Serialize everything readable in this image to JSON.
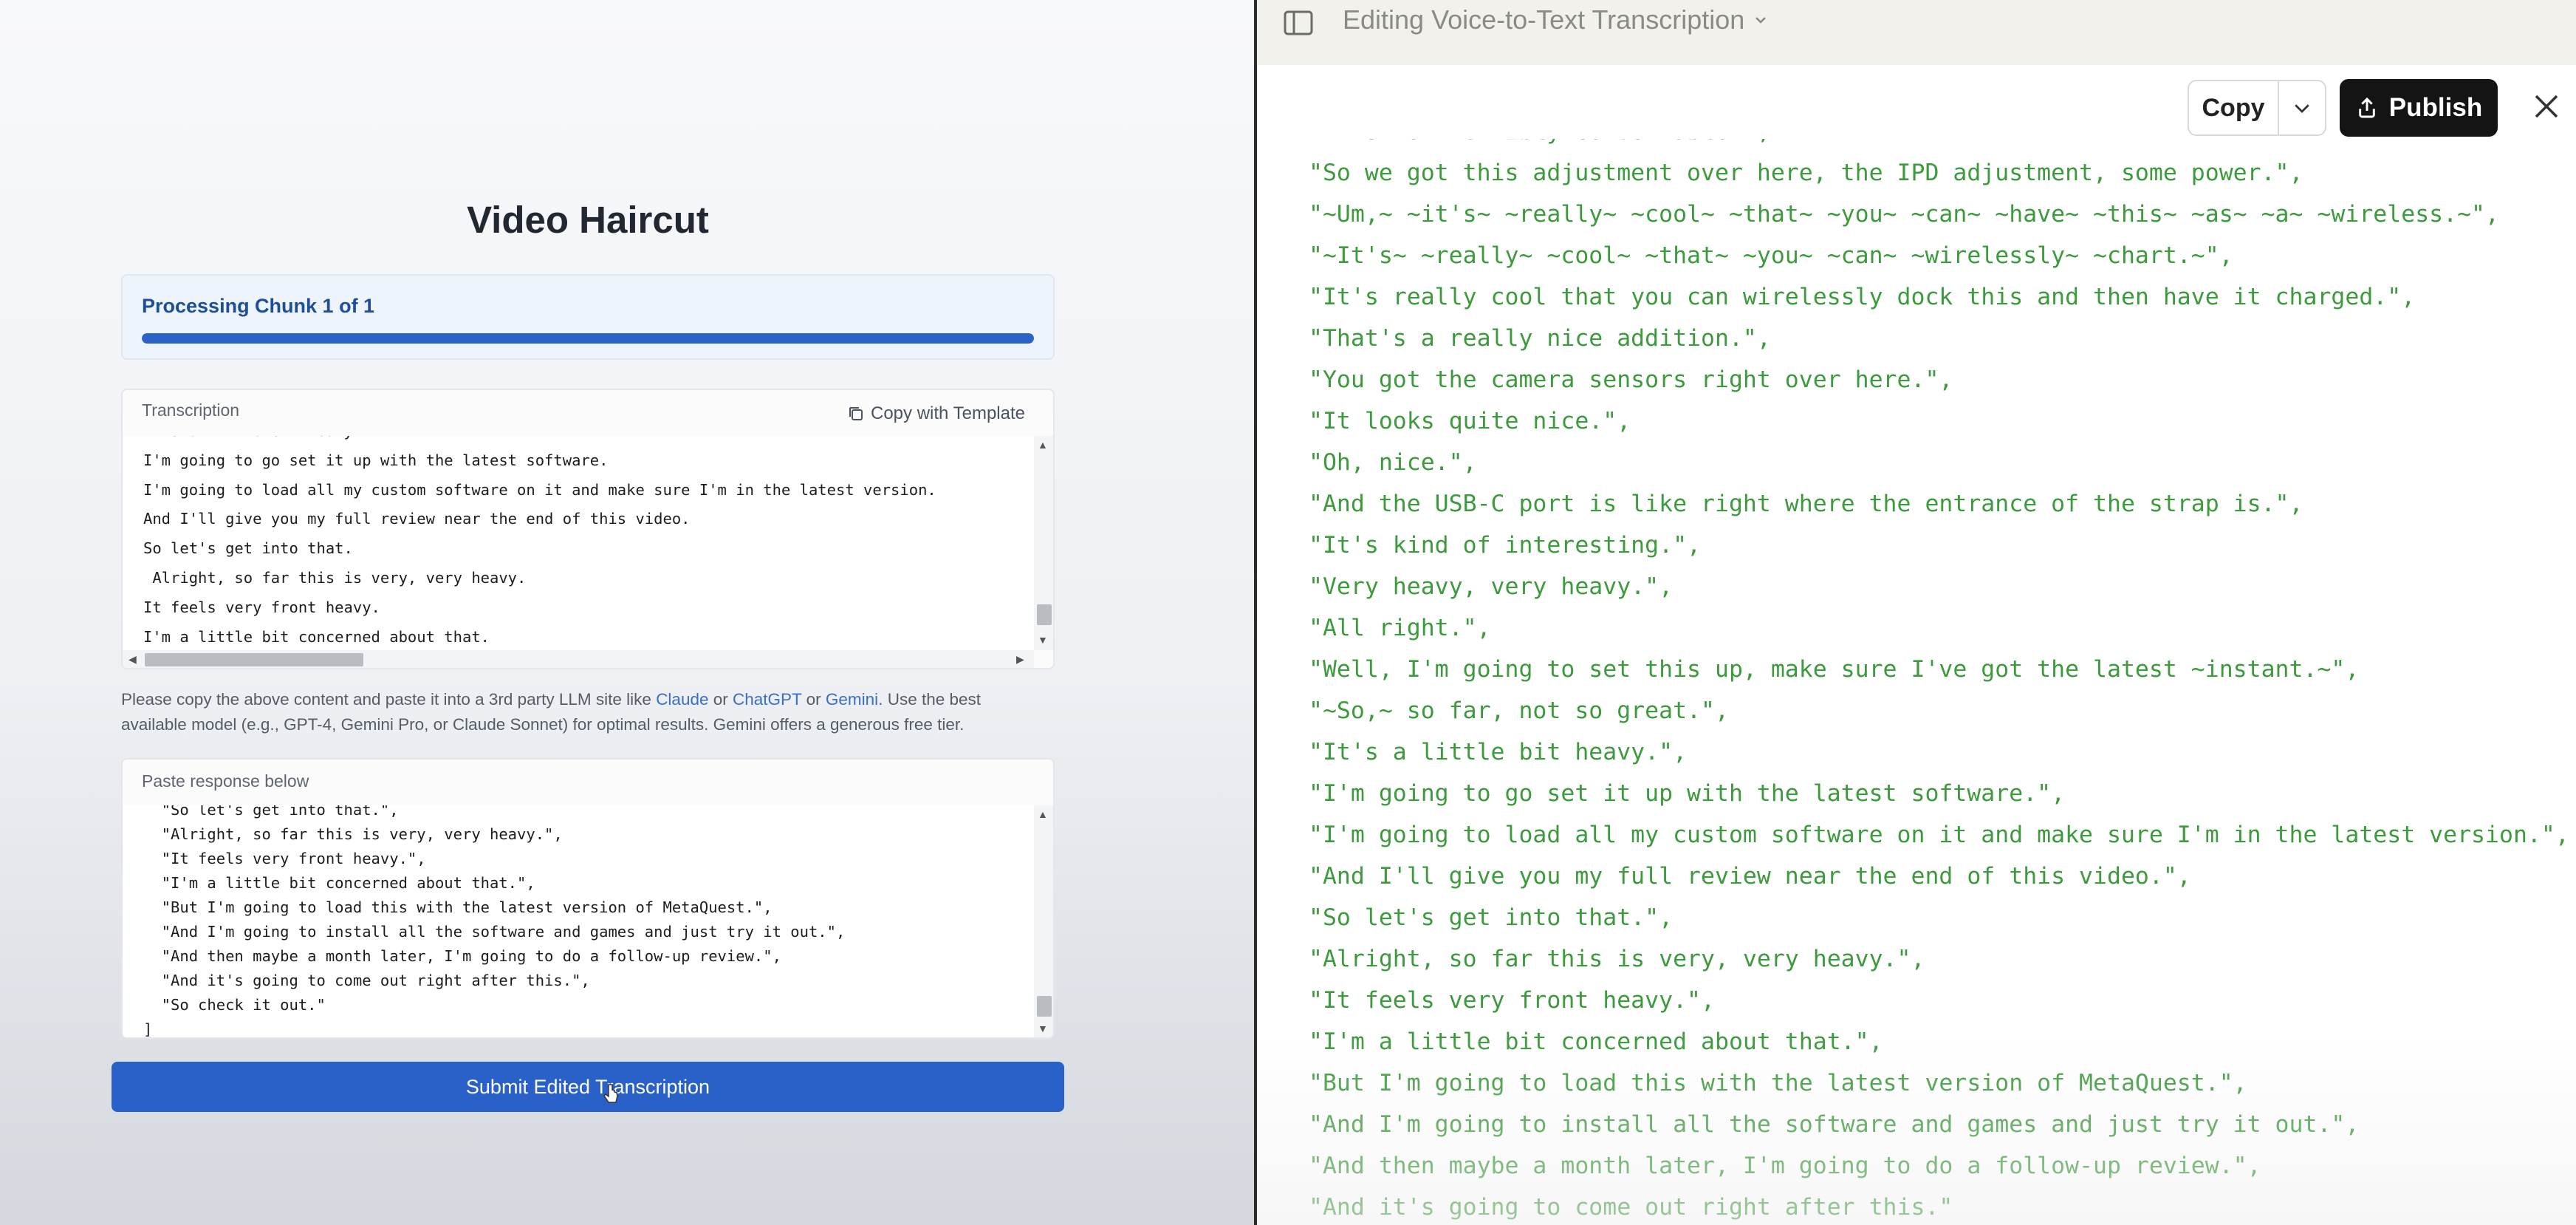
{
  "left": {
    "title": "Video Haircut",
    "progress": {
      "label": "Processing Chunk 1 of 1",
      "fraction": 1.0
    },
    "transcription": {
      "label": "Transcription",
      "copy_label": "Copy with Template",
      "lines": [
        "It's a little bit heavy.",
        "I'm going to go set it up with the latest software.",
        "I'm going to load all my custom software on it and make sure I'm in the latest version.",
        "And I'll give you my full review near the end of this video.",
        "So let's get into that.",
        " Alright, so far this is very, very heavy.",
        "It feels very front heavy.",
        "I'm a little bit concerned about that."
      ]
    },
    "note": {
      "text1": "Please copy the above content and paste it into a 3rd party LLM site like ",
      "link1": "Claude",
      "text2": " or ",
      "link2": "ChatGPT",
      "text3": " or ",
      "link3": "Gemini",
      "text4": ". Use the best available model (e.g., GPT-4, Gemini Pro, or Claude Sonnet) for optimal results. Gemini offers a generous free tier."
    },
    "response": {
      "label": "Paste response below",
      "lines": [
        "  \"So let's get into that.\",",
        "  \"Alright, so far this is very, very heavy.\",",
        "  \"It feels very front heavy.\",",
        "  \"I'm a little bit concerned about that.\",",
        "  \"But I'm going to load this with the latest version of MetaQuest.\",",
        "  \"And I'm going to install all the software and games and just try it out.\",",
        "  \"And then maybe a month later, I'm going to do a follow-up review.\",",
        "  \"And it's going to come out right after this.\",",
        "  \"So check it out.\"",
        "]"
      ]
    },
    "submit_label": "Submit Edited Transcription"
  },
  "right": {
    "doc_title": "Editing Voice-to-Text Transcription",
    "copy_label": "Copy",
    "publish_label": "Publish",
    "code_lines": [
      "\"It's not terribly comfortable.\",",
      "\"So we got this adjustment over here, the IPD adjustment, some power.\",",
      "\"~Um,~ ~it's~ ~really~ ~cool~ ~that~ ~you~ ~can~ ~have~ ~this~ ~as~ ~a~ ~wireless.~\",",
      "\"~It's~ ~really~ ~cool~ ~that~ ~you~ ~can~ ~wirelessly~ ~chart.~\",",
      "\"It's really cool that you can wirelessly dock this and then have it charged.\",",
      "\"That's a really nice addition.\",",
      "\"You got the camera sensors right over here.\",",
      "\"It looks quite nice.\",",
      "\"Oh, nice.\",",
      "\"And the USB-C port is like right where the entrance of the strap is.\",",
      "\"It's kind of interesting.\",",
      "\"Very heavy, very heavy.\",",
      "\"All right.\",",
      "\"Well, I'm going to set this up, make sure I've got the latest ~instant.~\",",
      "\"~So,~ so far, not so great.\",",
      "\"It's a little bit heavy.\",",
      "\"I'm going to go set it up with the latest software.\",",
      "\"I'm going to load all my custom software on it and make sure I'm in the latest version.\",",
      "\"And I'll give you my full review near the end of this video.\",",
      "\"So let's get into that.\",",
      "\"Alright, so far this is very, very heavy.\",",
      "\"It feels very front heavy.\",",
      "\"I'm a little bit concerned about that.\",",
      "\"But I'm going to load this with the latest version of MetaQuest.\",",
      "\"And I'm going to install all the software and games and just try it out.\",",
      "\"And then maybe a month later, I'm going to do a follow-up review.\",",
      "\"And it's going to come out right after this.\""
    ]
  },
  "colors": {
    "accent": "#2961c8",
    "code_green": "#3d9a3d",
    "publish_bg": "#141414"
  }
}
